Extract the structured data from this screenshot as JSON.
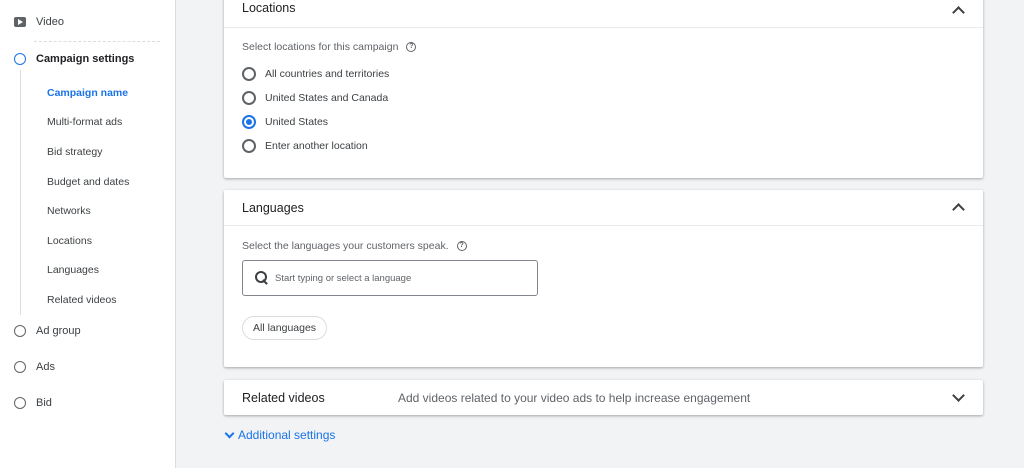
{
  "sidebar": {
    "video_label": "Video",
    "campaign_settings_label": "Campaign settings",
    "substeps": [
      "Campaign name",
      "Multi-format ads",
      "Bid strategy",
      "Budget and dates",
      "Networks",
      "Locations",
      "Languages",
      "Related videos"
    ],
    "ad_group_label": "Ad group",
    "ads_label": "Ads",
    "bid_label": "Bid"
  },
  "locations": {
    "title": "Locations",
    "prompt": "Select locations for this campaign",
    "options": [
      "All countries and territories",
      "United States and Canada",
      "United States",
      "Enter another location"
    ],
    "selected": "United States"
  },
  "languages": {
    "title": "Languages",
    "prompt": "Select the languages your customers speak.",
    "search_placeholder": "Start typing or select a language",
    "chip": "All languages"
  },
  "related_videos": {
    "title": "Related videos",
    "description": "Add videos related to your video ads to help increase engagement"
  },
  "additional_settings": "Additional settings",
  "icons": {
    "help": "?"
  },
  "colors": {
    "accent": "#1a73e8",
    "background": "#f1f3f4"
  }
}
